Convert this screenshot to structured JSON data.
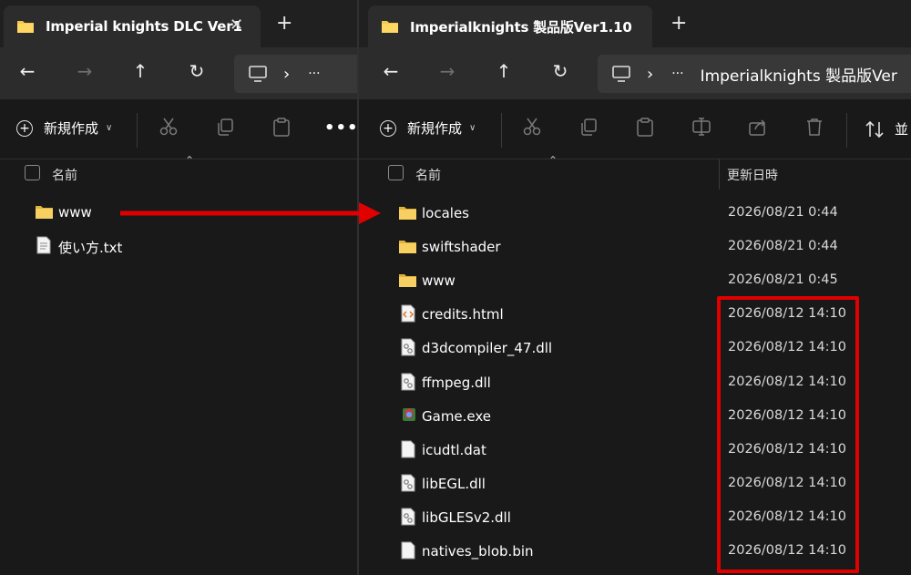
{
  "left_window": {
    "tab_title": "Imperial knights DLC Ver1",
    "close_glyph": "✕",
    "new_tab_glyph": "+",
    "nav": {
      "back": "←",
      "forward": "→",
      "up": "↑",
      "refresh": "↻",
      "chevron": "›",
      "more": "···"
    },
    "toolbar": {
      "new_label": "新規作成",
      "more": "•••"
    },
    "header": {
      "name_col": "名前"
    },
    "files": [
      {
        "name": "www",
        "icon": "folder-icon"
      },
      {
        "name": "使い方.txt",
        "icon": "text-file-icon"
      }
    ]
  },
  "right_window": {
    "tab_title": "Imperialknights 製品版Ver1.10",
    "close_glyph": "✕",
    "new_tab_glyph": "+",
    "nav": {
      "back": "←",
      "forward": "→",
      "up": "↑",
      "refresh": "↻",
      "chevron": "›",
      "more": "···"
    },
    "address_path": "Imperialknights 製品版Ver",
    "toolbar": {
      "new_label": "新規作成",
      "sort_label": "並"
    },
    "header": {
      "name_col": "名前",
      "date_col": "更新日時"
    },
    "files": [
      {
        "name": "locales",
        "date": "2026/08/21 0:44",
        "icon": "folder-icon"
      },
      {
        "name": "swiftshader",
        "date": "2026/08/21 0:44",
        "icon": "folder-icon"
      },
      {
        "name": "www",
        "date": "2026/08/21 0:45",
        "icon": "folder-icon"
      },
      {
        "name": "credits.html",
        "date": "2026/08/12 14:10",
        "icon": "html-file-icon"
      },
      {
        "name": "d3dcompiler_47.dll",
        "date": "2026/08/12 14:10",
        "icon": "dll-file-icon"
      },
      {
        "name": "ffmpeg.dll",
        "date": "2026/08/12 14:10",
        "icon": "dll-file-icon"
      },
      {
        "name": "Game.exe",
        "date": "2026/08/12 14:10",
        "icon": "game-exe-icon"
      },
      {
        "name": "icudtl.dat",
        "date": "2026/08/12 14:10",
        "icon": "blank-file-icon"
      },
      {
        "name": "libEGL.dll",
        "date": "2026/08/12 14:10",
        "icon": "dll-file-icon"
      },
      {
        "name": "libGLESv2.dll",
        "date": "2026/08/12 14:10",
        "icon": "dll-file-icon"
      },
      {
        "name": "natives_blob.bin",
        "date": "2026/08/12 14:10",
        "icon": "blank-file-icon"
      }
    ]
  },
  "annotations": {
    "arrow_color": "#e00000",
    "highlight_color": "#e00000"
  },
  "colors": {
    "background": "#191919",
    "tab_active": "#2c2c2c",
    "folder": "#f5c84c"
  }
}
